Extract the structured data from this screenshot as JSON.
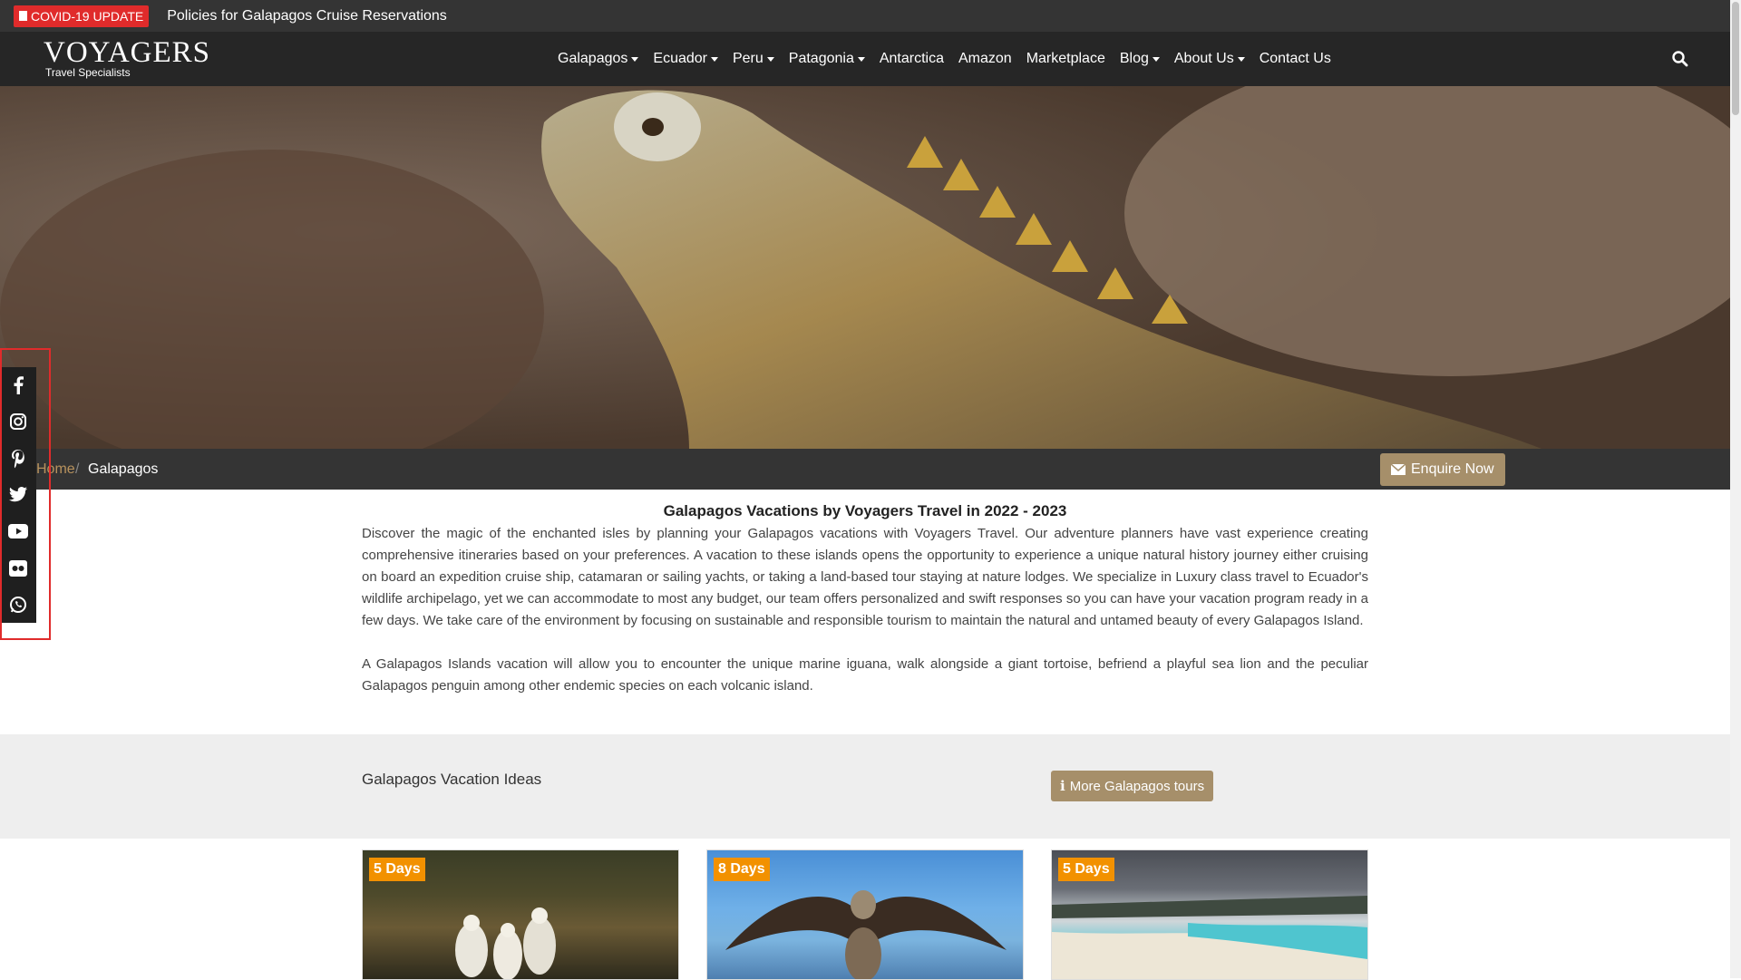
{
  "topbar": {
    "badge_label": "COVID-19 UPDATE",
    "policy_link": "Policies for Galapagos Cruise Reservations"
  },
  "brand": {
    "name": "VOYAGERS",
    "tagline": "Travel Specialists"
  },
  "nav": {
    "items": [
      {
        "label": "Galapagos",
        "dropdown": true
      },
      {
        "label": "Ecuador",
        "dropdown": true
      },
      {
        "label": "Peru",
        "dropdown": true
      },
      {
        "label": "Patagonia",
        "dropdown": true
      },
      {
        "label": "Antarctica",
        "dropdown": false
      },
      {
        "label": "Amazon",
        "dropdown": false
      },
      {
        "label": "Marketplace",
        "dropdown": false
      },
      {
        "label": "Blog",
        "dropdown": true
      },
      {
        "label": "About Us",
        "dropdown": true
      },
      {
        "label": "Contact Us",
        "dropdown": false
      }
    ]
  },
  "breadcrumb": {
    "home": "Home",
    "separator": "/",
    "current": "Galapagos"
  },
  "enquire_label": "Enquire Now",
  "social": [
    "facebook-icon",
    "instagram-icon",
    "pinterest-icon",
    "twitter-icon",
    "youtube-icon",
    "flickr-icon",
    "whatsapp-icon"
  ],
  "intro": {
    "title": "Galapagos Vacations by Voyagers Travel in 2022 - 2023",
    "paragraph1": "Discover the magic of the enchanted isles by planning your Galapagos vacations with Voyagers Travel. Our adventure planners have vast experience creating comprehensive itineraries based on your preferences. A vacation to these islands opens the opportunity to experience a unique natural history journey either cruising on board an expedition cruise ship, catamaran or sailing yachts, or taking a land-based tour staying at nature lodges. We specialize in Luxury class travel to Ecuador's wildlife archipelago, yet we can accommodate to most any budget, our team offers personalized and swift responses so you can have your vacation program ready in a few days. We take care of the environment by focusing on sustainable and responsible tourism to maintain the natural and untamed beauty of every Galapagos Island.",
    "paragraph2": "A Galapagos Islands vacation will allow you to encounter the unique marine iguana, walk alongside a giant tortoise, befriend a playful sea lion and the peculiar Galapagos penguin among other endemic species on each volcanic island."
  },
  "ideas": {
    "title": "Galapagos Vacation Ideas",
    "more_label": "More Galapagos tours"
  },
  "cards": [
    {
      "badge": "5 Days"
    },
    {
      "badge": "8 Days"
    },
    {
      "badge": "5 Days"
    }
  ],
  "colors": {
    "topbar": "#343434",
    "navbar": "#262626",
    "accent_gold": "#a68f6a",
    "badge_orange": "#f29100",
    "covid_red": "#e02b2b"
  }
}
